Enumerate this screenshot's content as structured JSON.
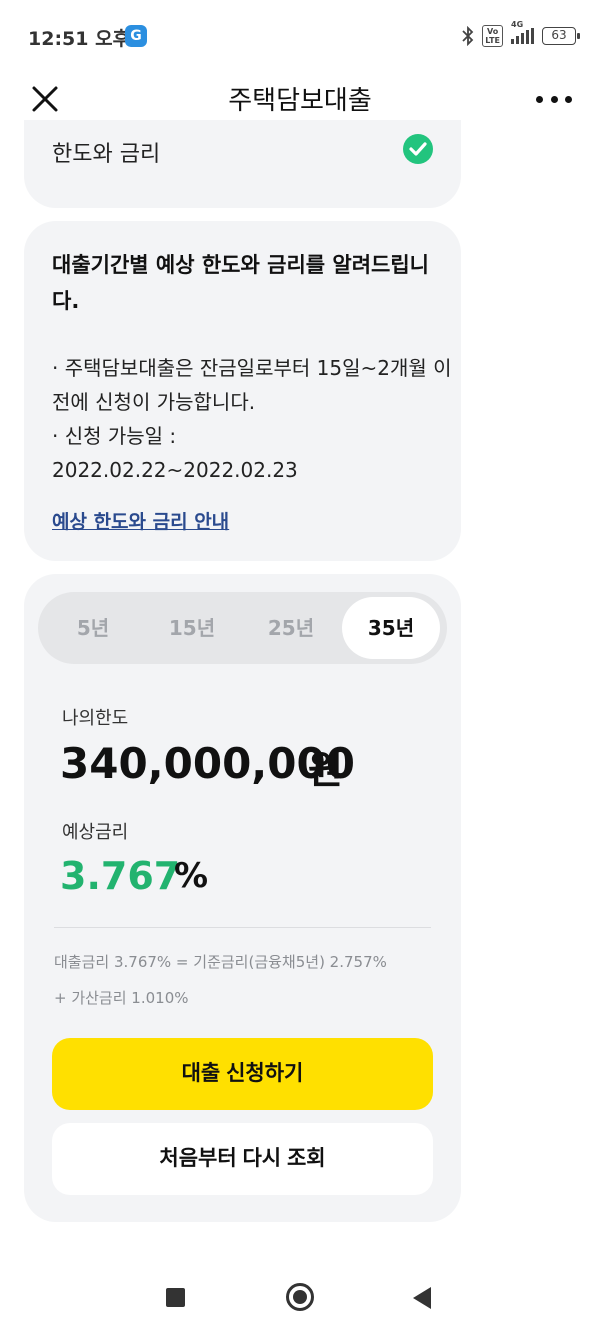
{
  "status_bar": {
    "time": "12:51 오후",
    "app_icon": "G",
    "volte_top": "Vo",
    "volte_bottom": "LTE",
    "network": "4G",
    "battery": "63",
    "icons": [
      "bluetooth-icon",
      "volte-icon",
      "signal-icon",
      "battery-icon"
    ]
  },
  "header": {
    "title": "주택담보대출",
    "close_icon": "close-icon",
    "more_icon": "more-icon"
  },
  "top_card": {
    "label": "한도와 금리",
    "status_icon": "check-circle-icon",
    "status_color": "#22c47e"
  },
  "info_card": {
    "heading": "대출기간별 예상 한도와 금리를 알려드립니다.",
    "line1": "· 주택담보대출은 잔금일로부터 15일~2개월 이전에 신청이 가능합니다.",
    "line2": "· 신청 가능일 :",
    "line3": "2022.02.22~2022.02.23",
    "link": "예상 한도와 금리 안내"
  },
  "main_card": {
    "tabs": [
      {
        "label": "5년",
        "active": false
      },
      {
        "label": "15년",
        "active": false
      },
      {
        "label": "25년",
        "active": false
      },
      {
        "label": "35년",
        "active": true
      }
    ],
    "limit_label": "나의한도",
    "limit_value": "340,000,000",
    "limit_unit": "원",
    "rate_label": "예상금리",
    "rate_value": "3.767",
    "rate_unit": "%",
    "rate_color": "#22b36f",
    "rate_detail_line1": "대출금리 3.767% = 기준금리(금융채5년) 2.757%",
    "rate_detail_line2": "+ 가산금리 1.010%",
    "apply_button": "대출 신청하기",
    "apply_color": "#ffe000",
    "retry_button": "처음부터 다시 조회"
  },
  "nav_bar": {
    "icons": [
      "recent-apps-icon",
      "home-icon",
      "back-icon"
    ]
  }
}
